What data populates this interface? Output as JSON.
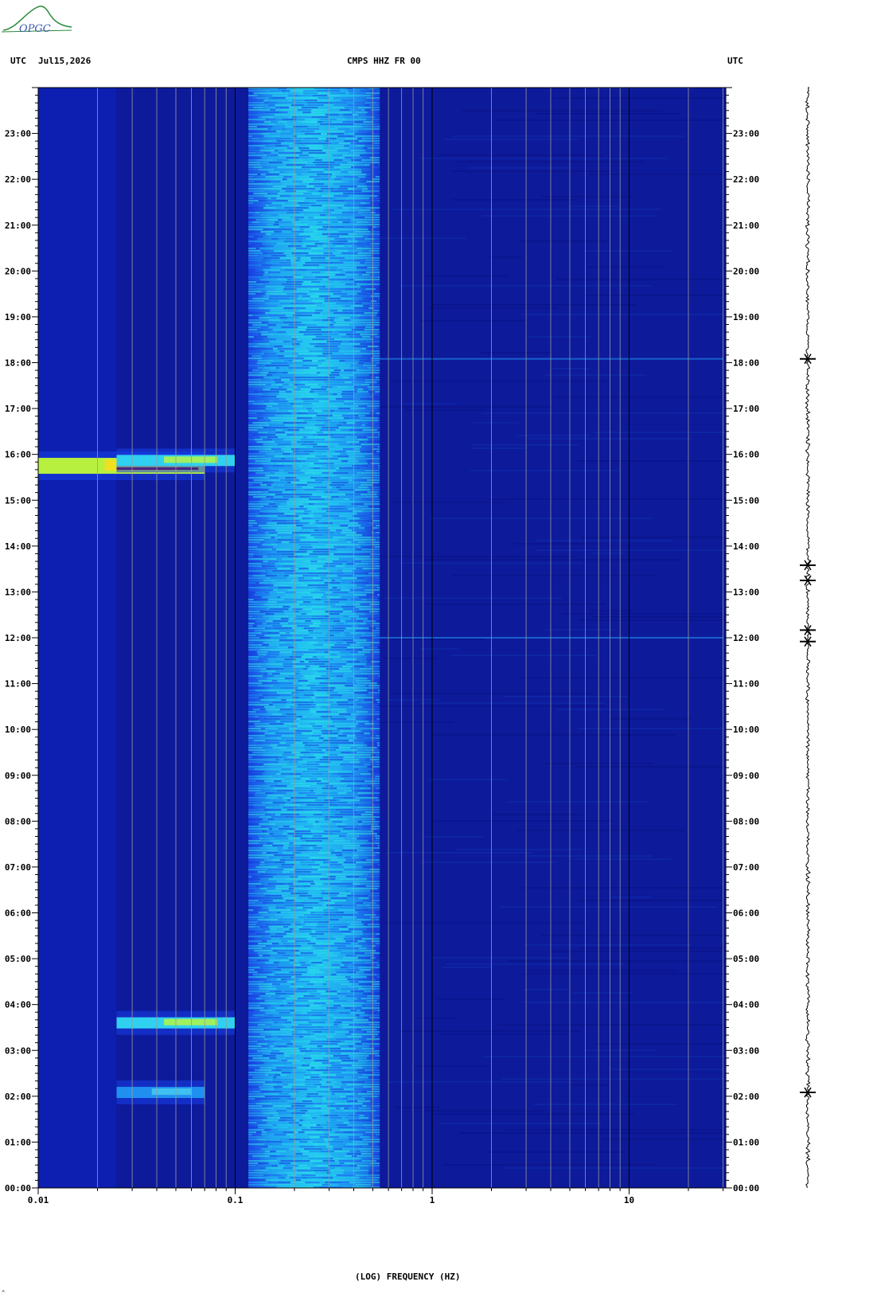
{
  "header": {
    "left_tz": "UTC",
    "date": "Jul15,2026",
    "station": "CMPS HHZ FR 00",
    "right_tz": "UTC"
  },
  "logo": {
    "text": "OPGC"
  },
  "corner_mark": "^",
  "chart_data": {
    "type": "heatmap",
    "title": "CMPS HHZ FR 00",
    "xlabel": "(LOG) FREQUENCY (HZ)",
    "ylabel": "UTC",
    "x_scale": "log",
    "xlim": [
      0.01,
      30
    ],
    "ylim": [
      0,
      24
    ],
    "x_tick_labels": [
      "0.01",
      "0.1",
      "1",
      "10"
    ],
    "x_tick_values": [
      0.01,
      0.1,
      1,
      10
    ],
    "y_tick_labels": [
      "00:00",
      "01:00",
      "02:00",
      "03:00",
      "04:00",
      "05:00",
      "06:00",
      "07:00",
      "08:00",
      "09:00",
      "10:00",
      "11:00",
      "12:00",
      "13:00",
      "14:00",
      "15:00",
      "16:00",
      "17:00",
      "18:00",
      "19:00",
      "20:00",
      "21:00",
      "22:00",
      "23:00"
    ],
    "y_tick_values": [
      0,
      1,
      2,
      3,
      4,
      5,
      6,
      7,
      8,
      9,
      10,
      11,
      12,
      13,
      14,
      15,
      16,
      17,
      18,
      19,
      20,
      21,
      22,
      23
    ],
    "colormap": [
      "#0a0a7a",
      "#1030c8",
      "#1a78f0",
      "#22d8f0",
      "#b8f040",
      "#f0e020",
      "#f04010",
      "#800000"
    ],
    "background_color": "#0d1a9a",
    "microseism_band_hz": [
      0.12,
      0.45
    ],
    "events": [
      {
        "time_utc": "15:45",
        "freq_range_hz": [
          0.01,
          0.07
        ],
        "peak_intensity": "high"
      },
      {
        "time_utc": "15:52",
        "freq_range_hz": [
          0.025,
          0.1
        ],
        "peak_intensity": "medium"
      },
      {
        "time_utc": "03:36",
        "freq_range_hz": [
          0.025,
          0.1
        ],
        "peak_intensity": "medium"
      },
      {
        "time_utc": "02:05",
        "freq_range_hz": [
          0.025,
          0.07
        ],
        "peak_intensity": "low"
      },
      {
        "time_utc": "18:05",
        "freq_range_hz": [
          0.5,
          30
        ],
        "peak_intensity": "low"
      },
      {
        "time_utc": "12:00",
        "freq_range_hz": [
          0.5,
          30
        ],
        "peak_intensity": "low"
      }
    ],
    "seismogram_events_utc": [
      "18:05",
      "13:35",
      "13:15",
      "12:10",
      "11:55",
      "02:05"
    ]
  }
}
